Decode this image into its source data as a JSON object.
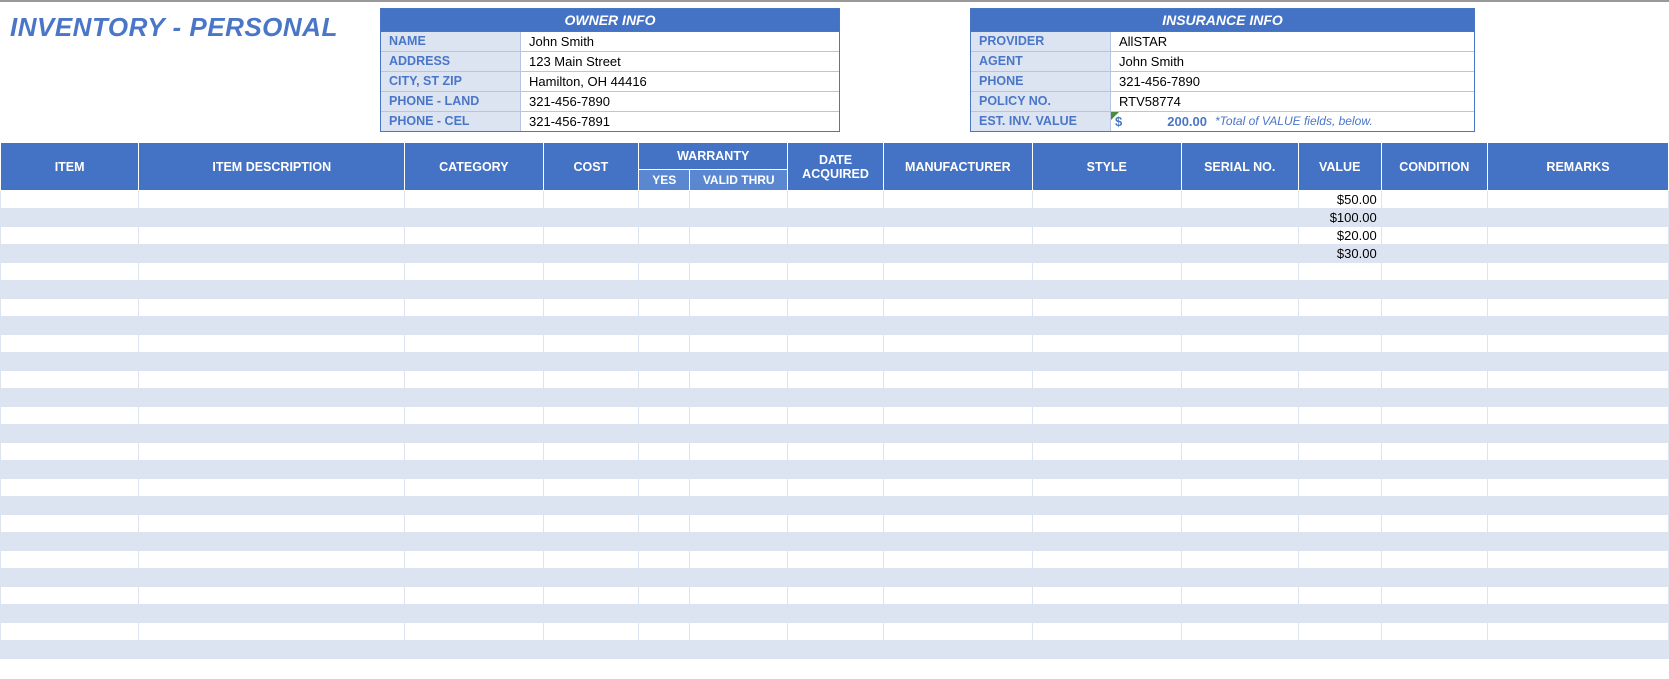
{
  "title": "INVENTORY - PERSONAL",
  "owner_info": {
    "header": "OWNER INFO",
    "rows": [
      {
        "label": "NAME",
        "value": "John Smith"
      },
      {
        "label": "ADDRESS",
        "value": "123 Main Street"
      },
      {
        "label": "CITY, ST  ZIP",
        "value": "Hamilton, OH  44416"
      },
      {
        "label": "PHONE - LAND",
        "value": "321-456-7890"
      },
      {
        "label": "PHONE - CEL",
        "value": "321-456-7891"
      }
    ]
  },
  "insurance_info": {
    "header": "INSURANCE INFO",
    "rows": [
      {
        "label": "PROVIDER",
        "value": "AllSTAR"
      },
      {
        "label": "AGENT",
        "value": "John Smith"
      },
      {
        "label": "PHONE",
        "value": "321-456-7890"
      },
      {
        "label": "POLICY NO.",
        "value": "RTV58774"
      }
    ],
    "est_label": "EST. INV. VALUE",
    "est_currency": "$",
    "est_value": "200.00",
    "est_note": "*Total of VALUE fields, below."
  },
  "columns": {
    "item": "ITEM",
    "desc": "ITEM DESCRIPTION",
    "cat": "CATEGORY",
    "cost": "COST",
    "warranty": "WARRANTY",
    "wyes": "YES",
    "wthru": "VALID THRU",
    "date": "DATE ACQUIRED",
    "mfr": "MANUFACTURER",
    "style": "STYLE",
    "serial": "SERIAL NO.",
    "value": "VALUE",
    "cond": "CONDITION",
    "remarks": "REMARKS"
  },
  "rows": [
    {
      "value": "$50.00"
    },
    {
      "value": "$100.00"
    },
    {
      "value": "$20.00"
    },
    {
      "value": "$30.00"
    },
    {},
    {},
    {},
    {},
    {},
    {},
    {},
    {},
    {},
    {},
    {},
    {},
    {},
    {},
    {},
    {},
    {},
    {},
    {},
    {},
    {},
    {}
  ]
}
